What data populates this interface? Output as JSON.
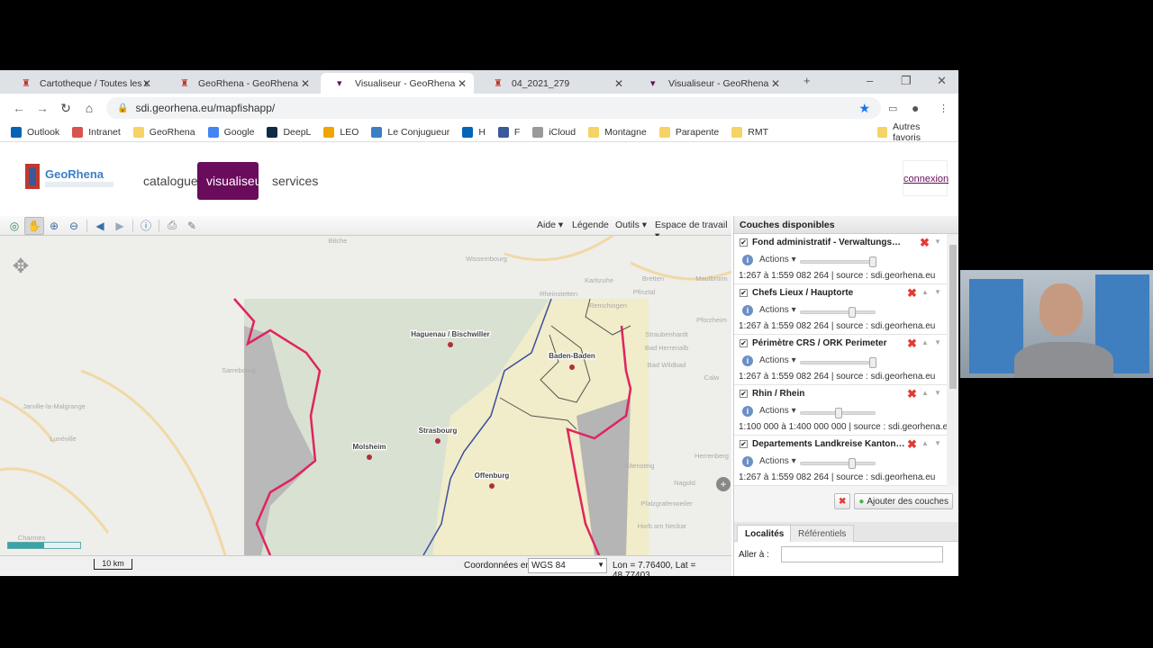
{
  "browser": {
    "tabs": [
      {
        "title": "Cartotheque / Toutes les ca",
        "active": false
      },
      {
        "title": "GeoRhena - GeoRhena",
        "active": false
      },
      {
        "title": "Visualiseur - GeoRhena",
        "active": true
      },
      {
        "title": "04_2021_279",
        "active": false
      },
      {
        "title": "Visualiseur - GeoRhena",
        "active": false
      }
    ],
    "url": "sdi.georhena.eu/mapfishapp/",
    "bookmarks": [
      "Outlook",
      "Intranet",
      "GeoRhena",
      "Google",
      "DeepL",
      "LEO",
      "Le Conjugueur",
      "H",
      "F",
      "iCloud",
      "Montagne",
      "Parapente",
      "RMT"
    ],
    "other_bookmarks": "Autres favoris"
  },
  "site": {
    "logo_text": "GeoRhena",
    "nav": [
      "catalogue",
      "visualiseur",
      "services"
    ],
    "active_nav": "visualiseur",
    "login": "connexion",
    "accent_color": "#6a0c5c"
  },
  "map_toolbar": {
    "menus": [
      "Aide ▾",
      "Légende",
      "Outils ▾",
      "Espace de travail ▾"
    ]
  },
  "map": {
    "places": [
      "Haguenau / Bischwiller",
      "Baden-Baden",
      "Strasbourg",
      "Molsheim",
      "Offenburg"
    ],
    "basemap_labels": [
      "Bitche",
      "Wissembourg",
      "Karlsruhe",
      "Rheinstetten",
      "Pfinztal",
      "Remchingen",
      "Bretten",
      "Maulbronn",
      "Pforzheim",
      "Straubenhardt",
      "Bad Herrenalb",
      "Bad Wildbad",
      "Calw",
      "Sarrebourg",
      "Jarville-la-Malgrange",
      "Lunéville",
      "Altensteig",
      "Nagold",
      "Pfalzgrafenweiler",
      "Horb am Neckar",
      "Charmes",
      "Herrenberg"
    ],
    "border_color": "#e0245e",
    "river_color": "#3b4fa0",
    "loading_progress": 0.5
  },
  "status": {
    "scale": "10 km",
    "coords_label": "Coordonnées en",
    "projection": "WGS 84",
    "coords": "Lon = 7.76400, Lat = 48.77403"
  },
  "panel": {
    "title": "Couches disponibles",
    "actions_label": "Actions ▾",
    "layers": [
      {
        "name": "Fond administratif - Verwaltungsbasi…",
        "meta": "1:267 à 1:559 082 264  |  source : sdi.georhena.eu",
        "opacity": 1.0
      },
      {
        "name": "Chefs Lieux / Hauptorte",
        "meta": "1:267 à 1:559 082 264  |  source : sdi.georhena.eu",
        "opacity": 0.7
      },
      {
        "name": "Périmètre CRS / ORK Perimeter",
        "meta": "1:267 à 1:559 082 264  |  source : sdi.georhena.eu",
        "opacity": 1.0
      },
      {
        "name": "Rhin / Rhein",
        "meta": "1:100 000 à 1:400 000 000  |  source : sdi.georhena.eu",
        "opacity": 0.5
      },
      {
        "name": "Departements Landkreise Kantonen",
        "meta": "1:267 à 1:559 082 264  |  source : sdi.georhena.eu",
        "opacity": 0.7
      }
    ],
    "add_layers": "Ajouter des couches",
    "bottom_tabs": [
      "Localités",
      "Référentiels"
    ],
    "goto_label": "Aller à :",
    "goto_value": ""
  }
}
